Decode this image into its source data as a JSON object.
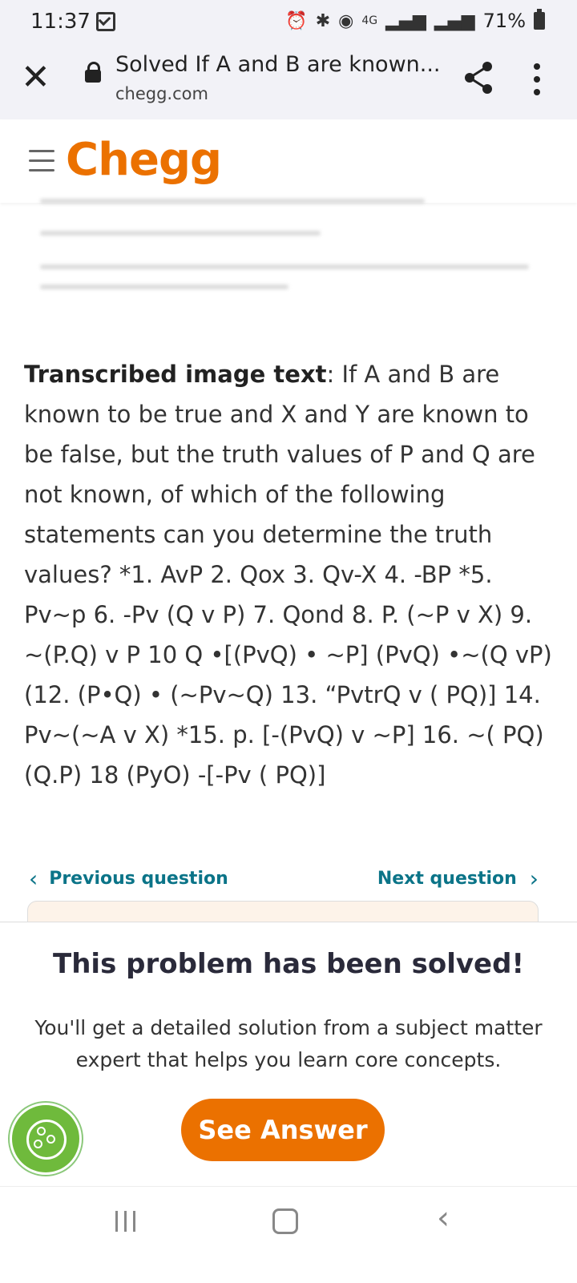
{
  "status_bar": {
    "time": "11:37",
    "network": "4G",
    "battery": "71%"
  },
  "browser": {
    "page_title": "Solved If A and B are known...",
    "domain": "chegg.com"
  },
  "header": {
    "logo": "Chegg"
  },
  "content": {
    "transcribed_label": "Transcribed image text",
    "transcribed_text": ": If A and B are known to be true and X and Y are known to be false, but the truth values of P and Q are not known, of which of the following statements can you determine the truth values? *1. AvP 2. Qox 3. Qv-X 4. -BP *5. Pv~p 6. -Pv (Q v P) 7. Qond 8. P. (~P v X) 9. ~(P.Q) v P 10 Q •[(PvQ) • ~P] (PvQ) •~(Q vP) (12. (P•Q) • (~Pv~Q) 13. “PvtrQ v ( PQ)] 14. Pv~(~A v X) *15. p. [-(PvQ) v ~P] 16. ~( PQ) (Q.P) 18 (PyO) -[-Pv ( PQ)]"
  },
  "navigation": {
    "previous": "Previous question",
    "next": "Next question"
  },
  "solved_panel": {
    "heading": "This problem has been solved!",
    "description": "You'll get a detailed solution from a subject matter expert that helps you learn core concepts.",
    "cta": "See Answer"
  },
  "colors": {
    "brand_orange": "#eb7100",
    "link_teal": "#0b7488",
    "cookie_green": "#6fba3c"
  }
}
